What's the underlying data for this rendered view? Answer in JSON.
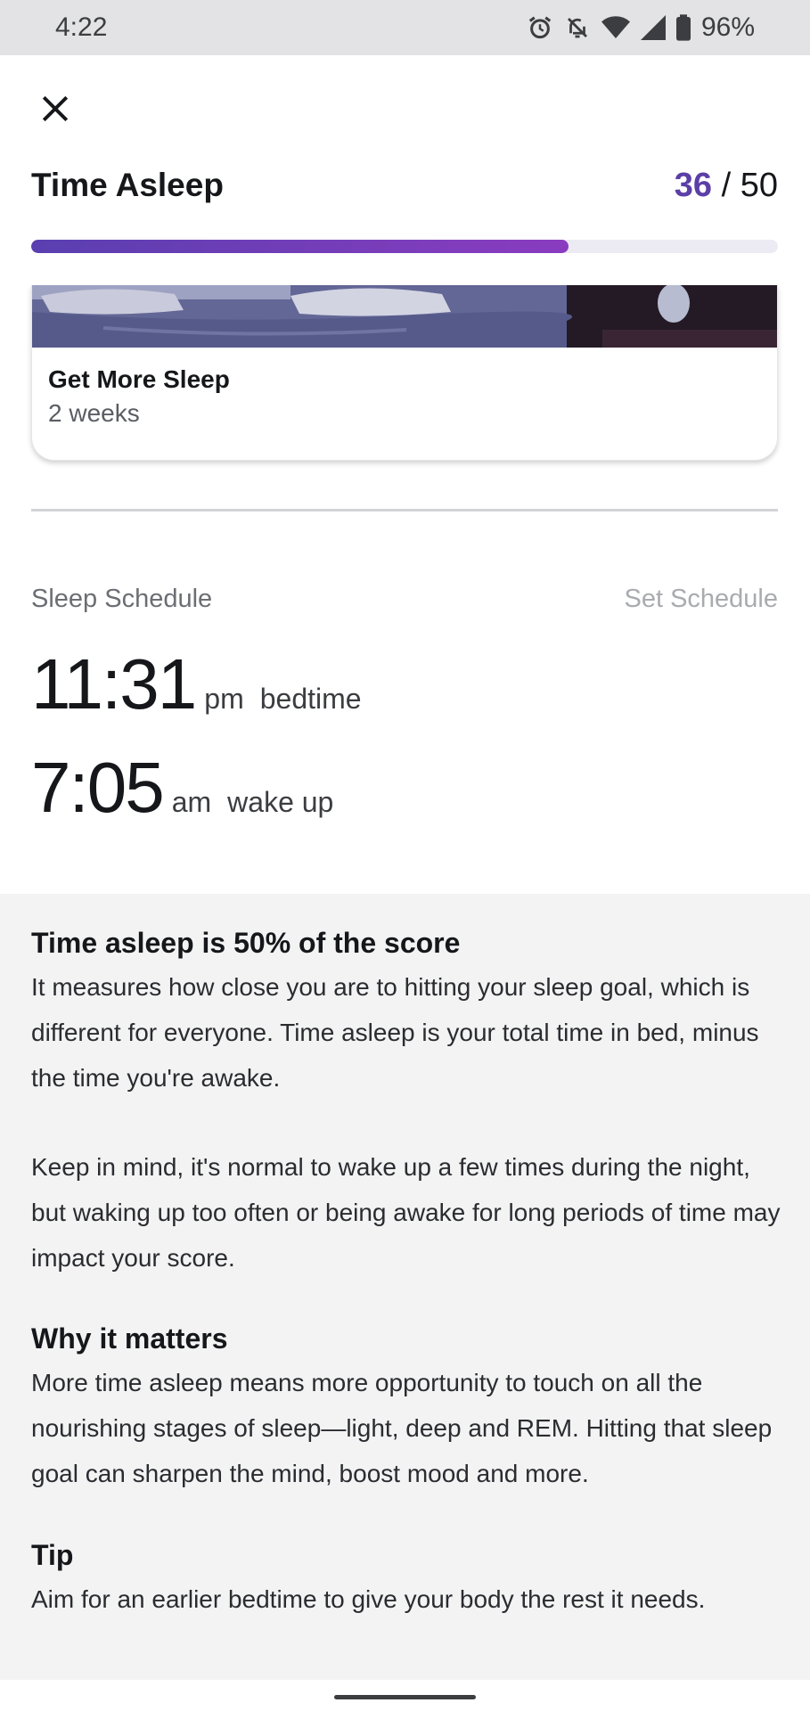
{
  "status_bar": {
    "time": "4:22",
    "battery": "96%",
    "icons": [
      "alarm-icon",
      "bell-off-icon",
      "wifi-icon",
      "signal-icon",
      "battery-icon"
    ]
  },
  "header": {
    "close_icon": "close-icon",
    "title": "Time Asleep",
    "score_value": "36",
    "score_sep": " / ",
    "score_max": "50",
    "progress_fraction": 0.72
  },
  "program_card": {
    "title": "Get More Sleep",
    "duration": "2 weeks"
  },
  "schedule": {
    "label": "Sleep Schedule",
    "action": "Set Schedule",
    "bedtime": {
      "time": "11:31",
      "ampm": "pm",
      "desc": "bedtime"
    },
    "wakeup": {
      "time": "7:05",
      "ampm": "am",
      "desc": "wake up"
    }
  },
  "info": {
    "heading1": "Time asleep is 50% of the score",
    "para1": "It measures how close you are to hitting your sleep goal, which is different for everyone. Time asleep is your total time in bed, minus the time you're awake.",
    "para2": "Keep in mind, it's normal to wake up a few times during the night, but waking up too often or being awake for long periods of time may impact your score.",
    "heading2": "Why it matters",
    "para3": "More time asleep means more opportunity to touch on all the nourishing stages of sleep—light, deep and REM. Hitting that sleep goal can sharpen the mind, boost mood and more.",
    "heading3": "Tip",
    "para4": "Aim for an earlier bedtime to give your body the rest it needs."
  },
  "colors": {
    "accent": "#5b3fa6",
    "progress_start": "#5a3fb0",
    "progress_end": "#8a3cc0",
    "info_bg": "#f3f3f4"
  }
}
